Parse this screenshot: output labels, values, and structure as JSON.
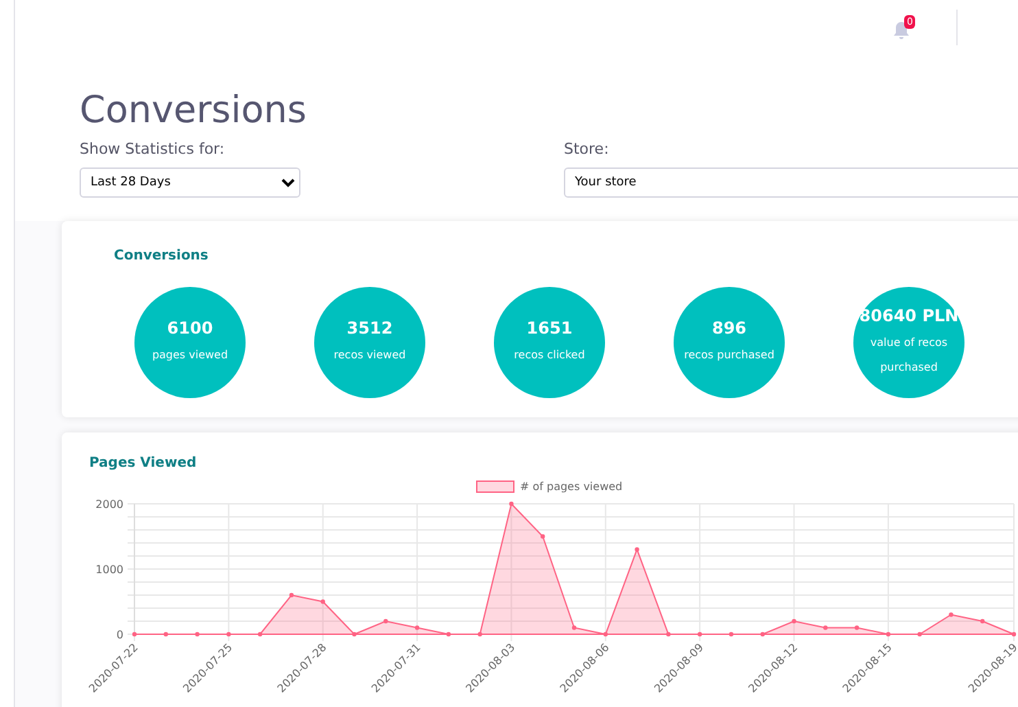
{
  "topbar": {
    "notification_count": "0"
  },
  "title": "Conversions",
  "filters": [
    {
      "label": "Show Statistics for:",
      "value": "Last 28 Days",
      "kind": "narrow"
    },
    {
      "label": "Store:",
      "value": "Your store",
      "kind": "wide"
    }
  ],
  "conversions": {
    "title": "Conversions",
    "stats": [
      {
        "value": "6100",
        "label": "pages viewed"
      },
      {
        "value": "3512",
        "label": "recos viewed"
      },
      {
        "value": "1651",
        "label": "recos clicked"
      },
      {
        "value": "896",
        "label": "recos purchased"
      },
      {
        "value": "80640 PLN",
        "label": "value of recos purchased"
      }
    ]
  },
  "pages_viewed": {
    "title": "Pages Viewed",
    "chart_data": {
      "type": "area",
      "categories": [
        "2020-07-22",
        null,
        null,
        "2020-07-25",
        null,
        null,
        "2020-07-28",
        null,
        null,
        "2020-07-31",
        null,
        null,
        "2020-08-03",
        null,
        null,
        "2020-08-06",
        null,
        null,
        "2020-08-09",
        null,
        null,
        "2020-08-12",
        null,
        null,
        "2020-08-15",
        null,
        null,
        null,
        "2020-08-19"
      ],
      "series": [
        {
          "name": "# of pages viewed",
          "color": "#ff6384",
          "values": [
            0,
            0,
            0,
            0,
            0,
            600,
            500,
            0,
            200,
            100,
            0,
            0,
            2000,
            1500,
            100,
            0,
            1300,
            0,
            0,
            0,
            0,
            200,
            100,
            100,
            0,
            0,
            300,
            200,
            0
          ]
        }
      ],
      "ylim": [
        0,
        2000
      ],
      "grid": true,
      "yticks": [
        0,
        1000,
        2000
      ]
    }
  }
}
